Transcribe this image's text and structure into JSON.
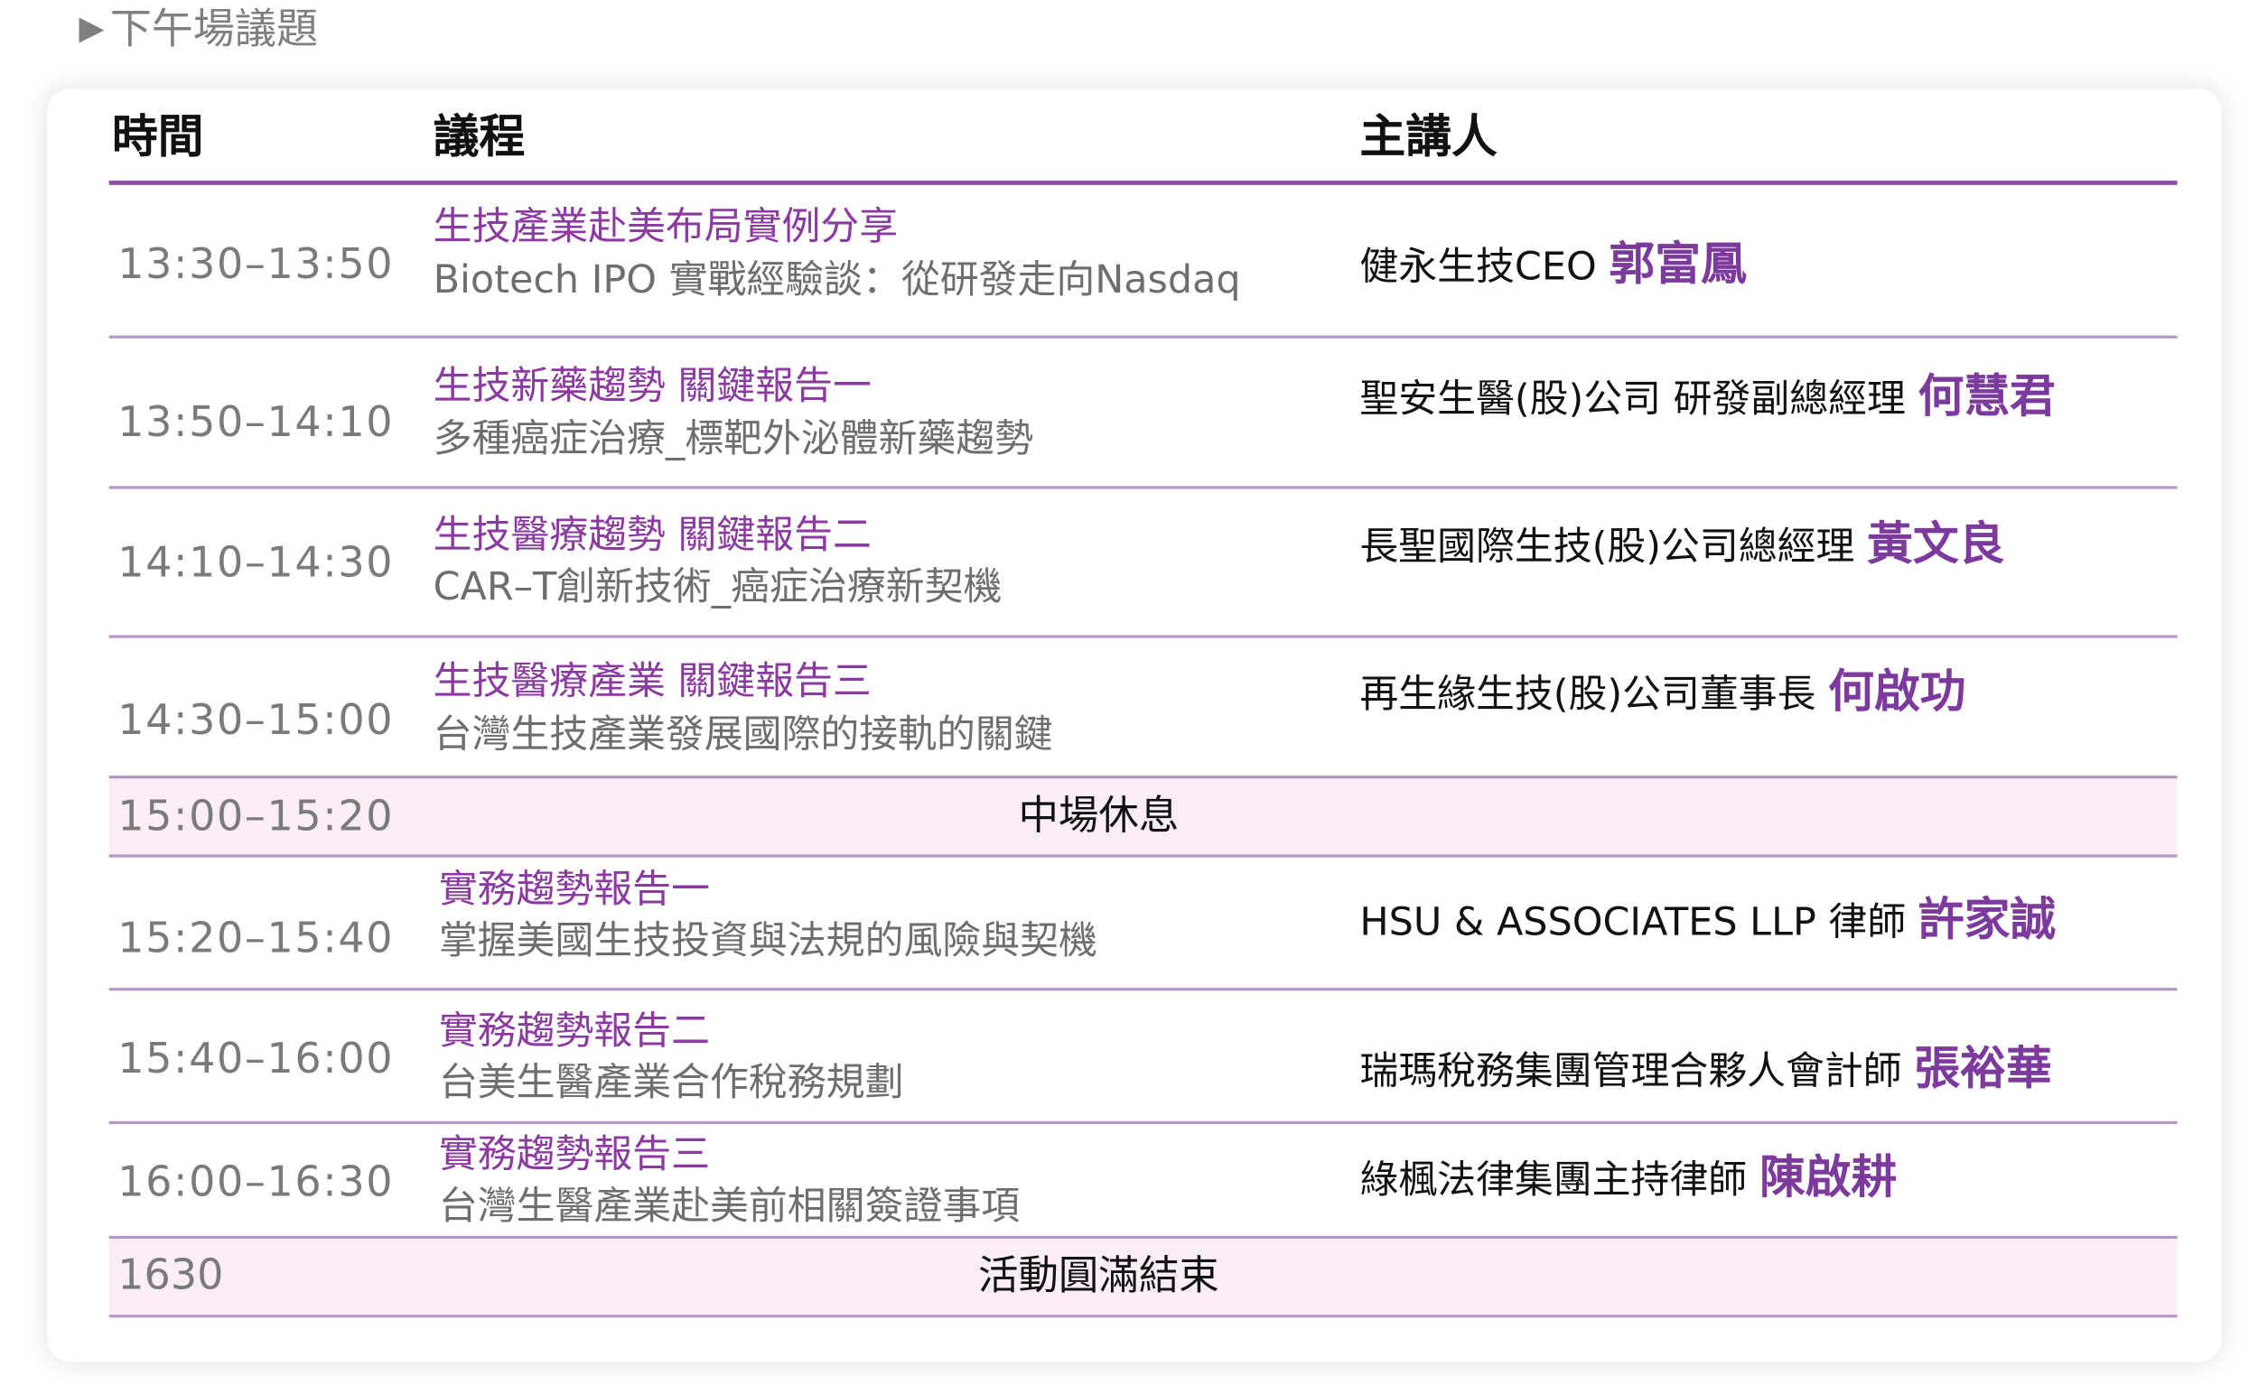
{
  "section_heading": {
    "arrow": "▶",
    "title": "下午場議題"
  },
  "table": {
    "headers": {
      "time": "時間",
      "agenda": "議程",
      "speaker": "主講人"
    },
    "rows": [
      {
        "time": "13:30–13:50",
        "title": "生技產業赴美布局實例分享",
        "subtitle": "Biotech IPO 實戰經驗談：從研發走向Nasdaq",
        "speaker_org": "健永生技CEO ",
        "speaker_name": "郭富鳳"
      },
      {
        "time": "13:50–14:10",
        "title": "生技新藥趨勢 關鍵報告一",
        "subtitle": "多種癌症治療_標靶外泌體新藥趨勢",
        "speaker_org": "聖安生醫(股)公司 研發副總經理 ",
        "speaker_name": "何慧君"
      },
      {
        "time": "14:10–14:30",
        "title": "生技醫療趨勢 關鍵報告二",
        "subtitle": "CAR–T創新技術_癌症治療新契機",
        "speaker_org": "長聖國際生技(股)公司總經理 ",
        "speaker_name": "黃文良"
      },
      {
        "time": "14:30–15:00",
        "title": "生技醫療產業 關鍵報告三",
        "subtitle": "台灣生技產業發展國際的接軌的關鍵",
        "speaker_org": "再生緣生技(股)公司董事長  ",
        "speaker_name": "何啟功"
      },
      {
        "time": "15:00–15:20",
        "break_label": "中場休息"
      },
      {
        "time": "15:20–15:40",
        "title": "實務趨勢報告一",
        "subtitle": "掌握美國生技投資與法規的風險與契機",
        "speaker_org": "HSU & ASSOCIATES LLP 律師 ",
        "speaker_name": "許家誠"
      },
      {
        "time": "15:40–16:00",
        "title": "實務趨勢報告二",
        "subtitle": "台美生醫產業合作稅務規劃",
        "speaker_org": "瑞瑪稅務集團管理合夥人會計師 ",
        "speaker_name": "張裕華"
      },
      {
        "time": "16:00–16:30",
        "title": "實務趨勢報告三",
        "subtitle": "台灣生醫產業赴美前相關簽證事項",
        "speaker_org": "綠楓法律集團主持律師 ",
        "speaker_name": "陳啟耕"
      },
      {
        "time": "1630",
        "break_label": "活動圓滿結束"
      }
    ]
  },
  "colors": {
    "accent_purple": "#8b3aa0",
    "header_rule": "#8a4da0",
    "row_rule": "#b596c4",
    "break_row_bg": "#faedf7",
    "muted_text": "#7a7a7a"
  }
}
